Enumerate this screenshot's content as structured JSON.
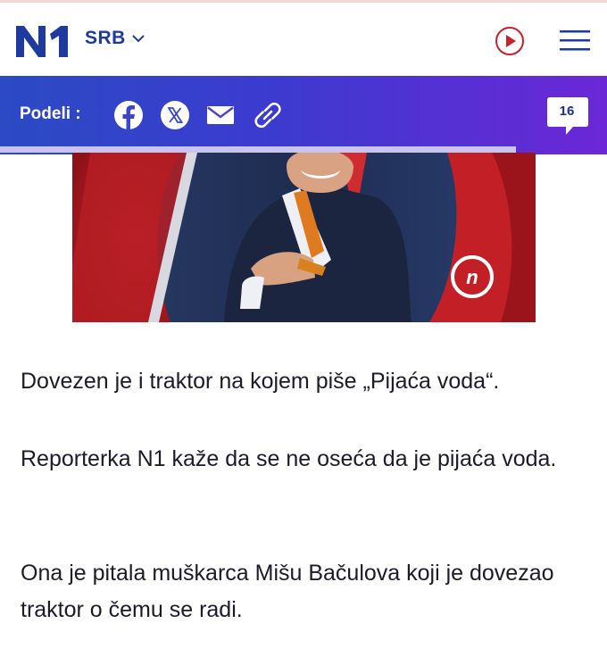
{
  "header": {
    "logo_text": "N1",
    "region_label": "SRB"
  },
  "sharebar": {
    "label": "Podeli :",
    "icons": [
      "facebook-icon",
      "x-icon",
      "mail-icon",
      "link-icon"
    ],
    "comment_count": "16",
    "read_progress": 0.85
  },
  "article": {
    "paragraphs": [
      "Dovezen je i traktor na kojem piše „Pijaća voda“.",
      "Reporterka N1 kaže da se ne oseća da je pijaća voda.",
      "Ona je pitala muškarca Mišu Bačulova koji je dovezao traktor o čemu se radi."
    ]
  },
  "colors": {
    "brand_blue": "#1f3a9e",
    "accent_red": "#c8202a",
    "sharebar_start": "#2b4ac4",
    "sharebar_end": "#6b27d6"
  }
}
